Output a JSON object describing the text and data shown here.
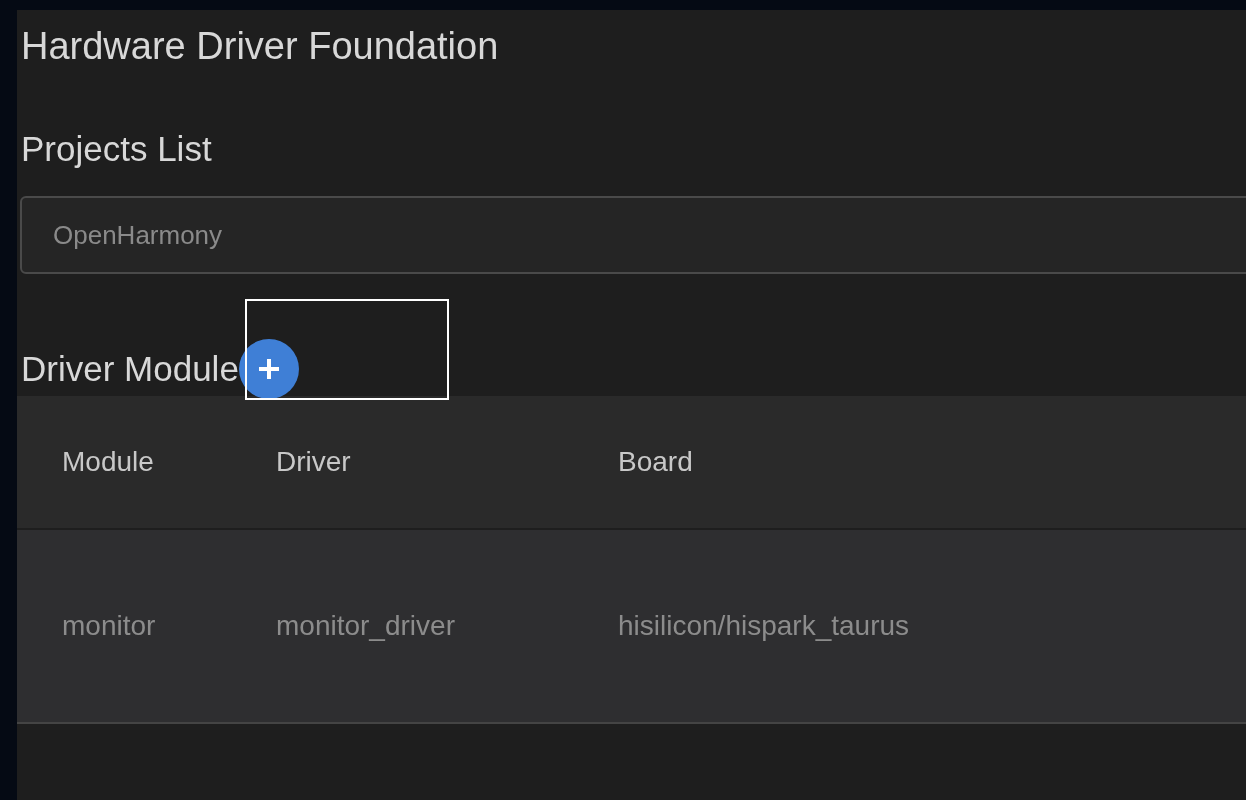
{
  "title": "Hardware Driver Foundation",
  "projects": {
    "heading": "Projects List",
    "value": "OpenHarmony"
  },
  "modules": {
    "heading": "Driver Module",
    "add_focused": true,
    "columns": [
      "Module",
      "Driver",
      "Board"
    ],
    "rows": [
      [
        "monitor",
        "monitor_driver",
        "hisilicon/hispark_taurus"
      ]
    ]
  }
}
